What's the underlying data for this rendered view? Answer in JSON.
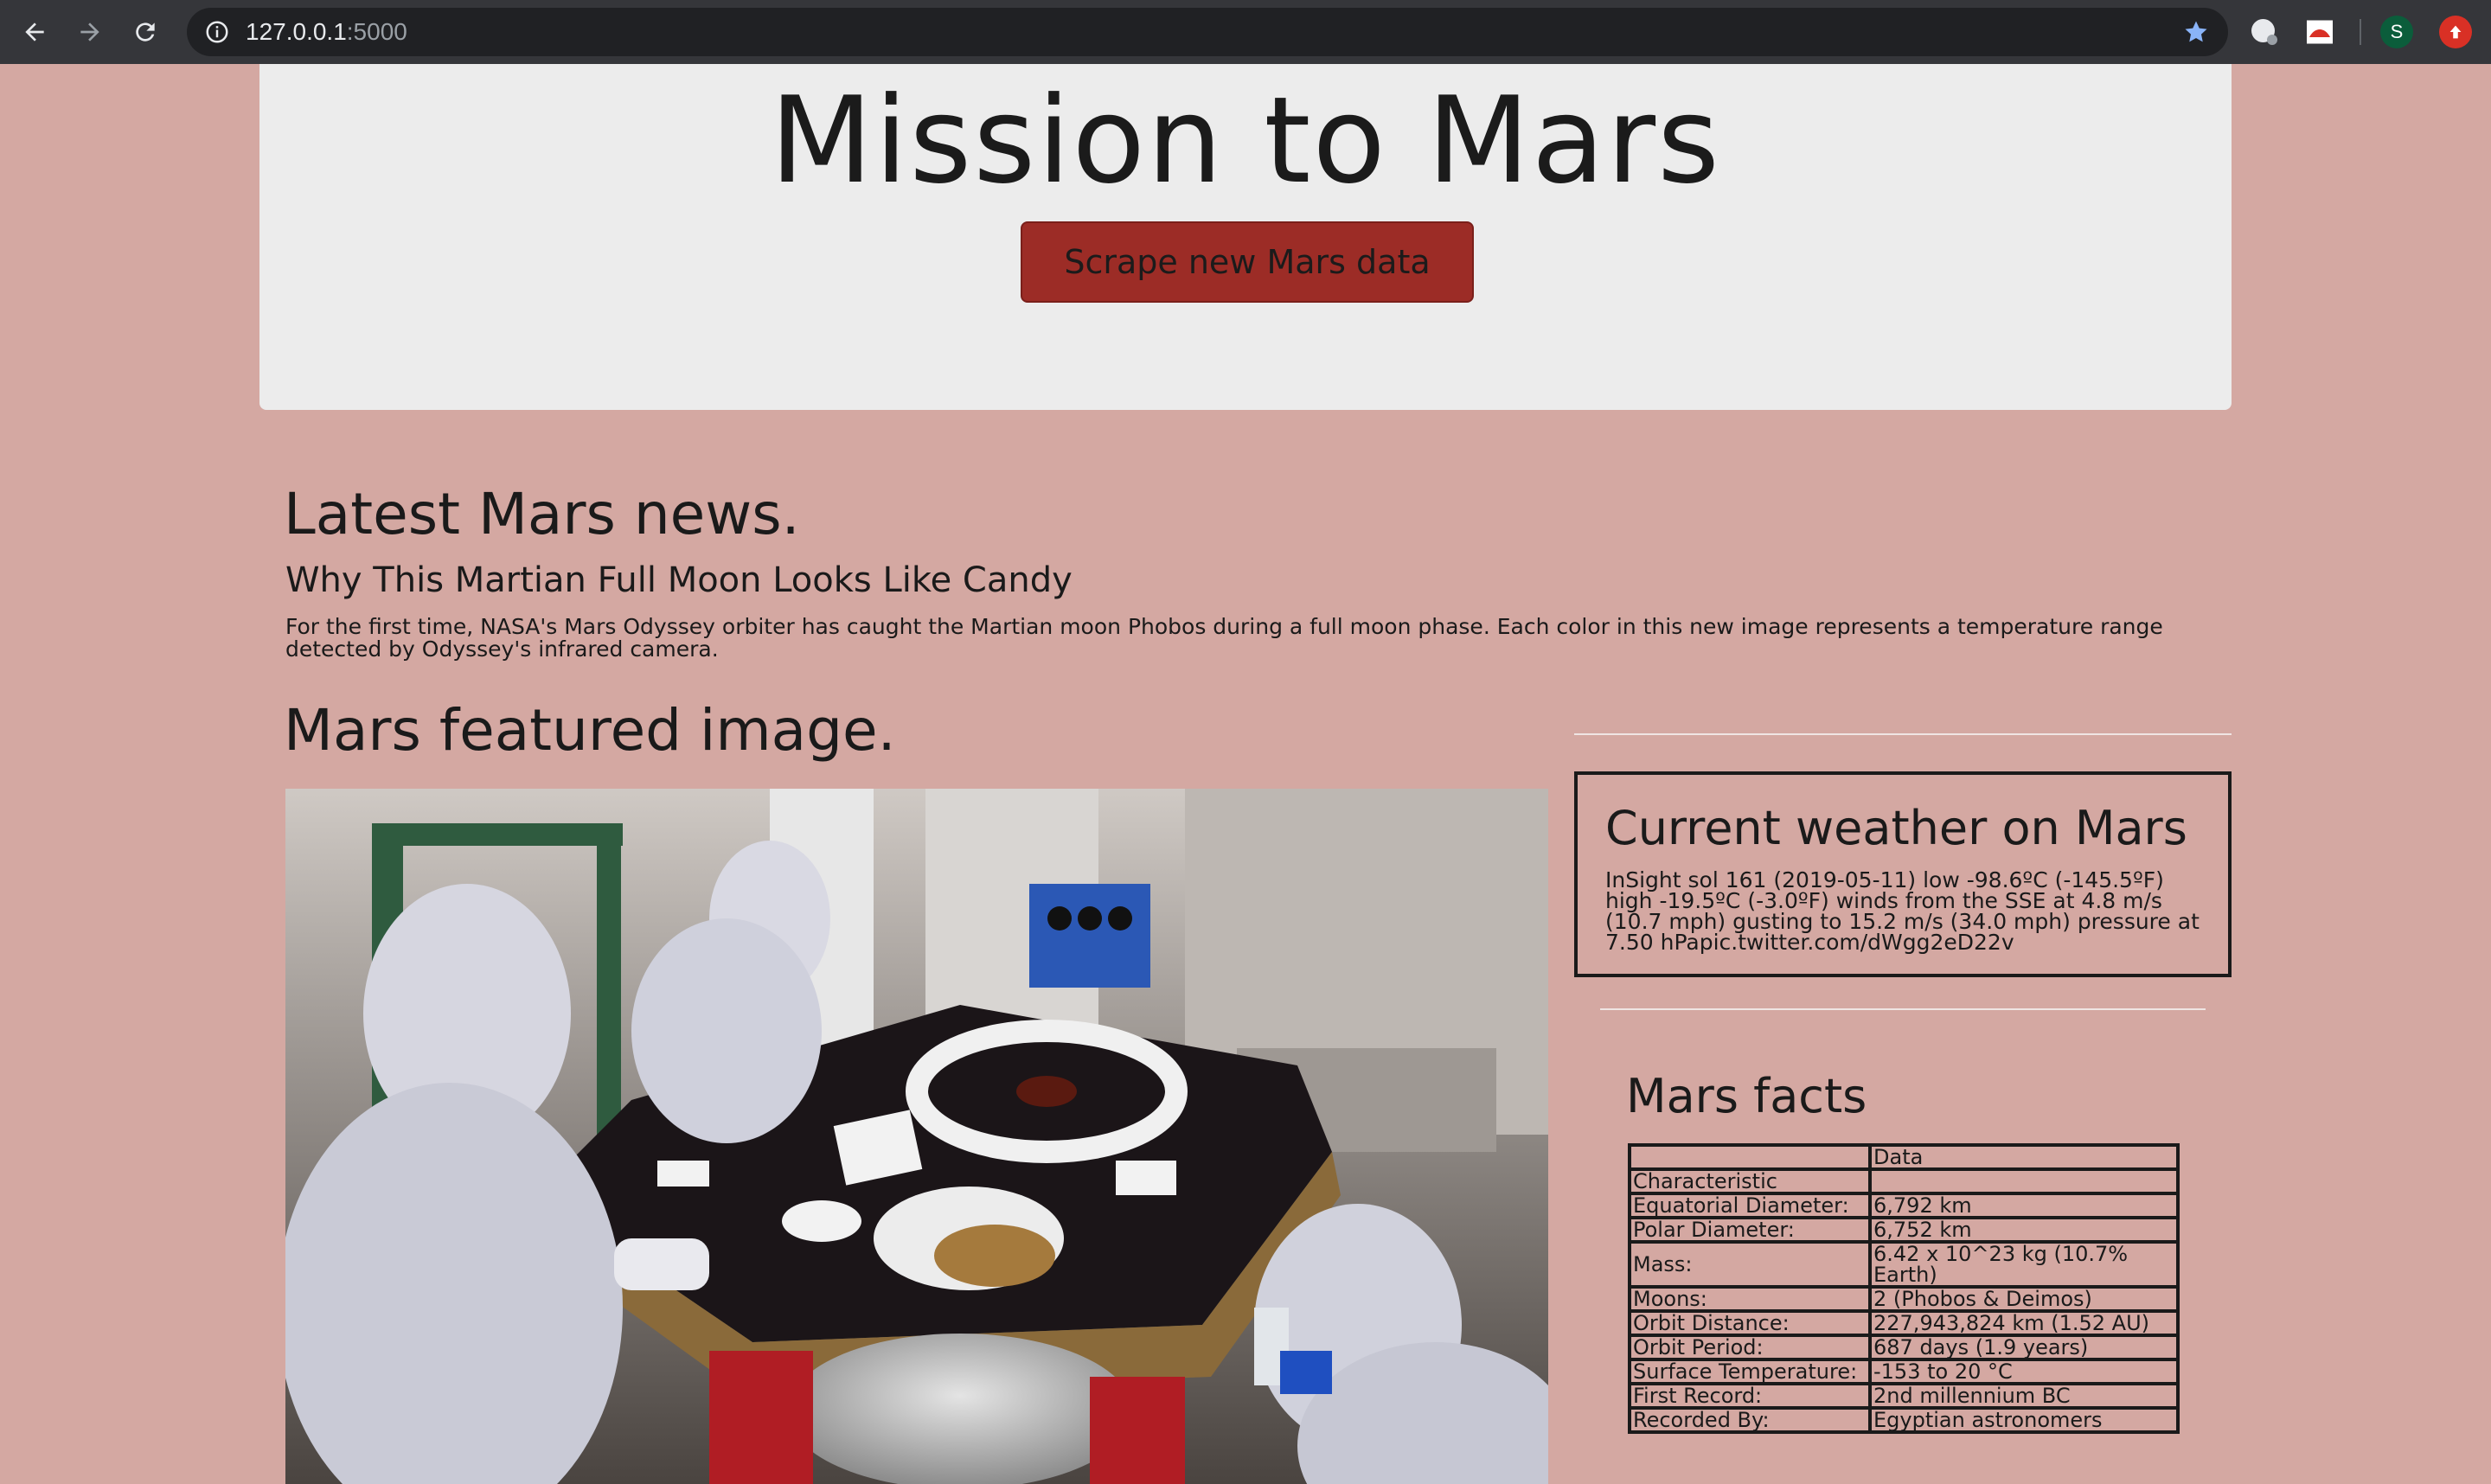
{
  "browser": {
    "url_host": "127.0.0.1",
    "url_port": ":5000",
    "icons": [
      "back-icon",
      "forward-icon",
      "reload-icon",
      "info-icon",
      "star-icon"
    ],
    "profile_initial": "S"
  },
  "header": {
    "title": "Mission to Mars",
    "scrape_button": "Scrape new Mars data"
  },
  "news": {
    "heading": "Latest Mars news.",
    "title": "Why This Martian Full Moon Looks Like Candy",
    "paragraph": "For the first time, NASA's Mars Odyssey orbiter has caught the Martian moon Phobos during a full moon phase. Each color in this new image represents a temperature range detected by Odyssey's infrared camera."
  },
  "featured": {
    "heading": "Mars featured image."
  },
  "weather": {
    "heading": "Current weather on Mars",
    "text": "InSight sol 161 (2019-05-11) low -98.6ºC (-145.5ºF) high -19.5ºC (-3.0ºF) winds from the SSE at 4.8 m/s (10.7 mph) gusting to 15.2 m/s (34.0 mph) pressure at 7.50 hPapic.twitter.com/dWgg2eD22v"
  },
  "facts": {
    "heading": "Mars facts",
    "header_row": [
      "",
      "Data"
    ],
    "index_label": "Characteristic",
    "rows": [
      [
        "Equatorial Diameter:",
        "6,792 km"
      ],
      [
        "Polar Diameter:",
        "6,752 km"
      ],
      [
        "Mass:",
        "6.42 x 10^23 kg (10.7% Earth)"
      ],
      [
        "Moons:",
        "2 (Phobos & Deimos)"
      ],
      [
        "Orbit Distance:",
        "227,943,824 km (1.52 AU)"
      ],
      [
        "Orbit Period:",
        "687 days (1.9 years)"
      ],
      [
        "Surface Temperature:",
        "-153 to 20 °C"
      ],
      [
        "First Record:",
        "2nd millennium BC"
      ],
      [
        "Recorded By:",
        "Egyptian astronomers"
      ]
    ]
  }
}
